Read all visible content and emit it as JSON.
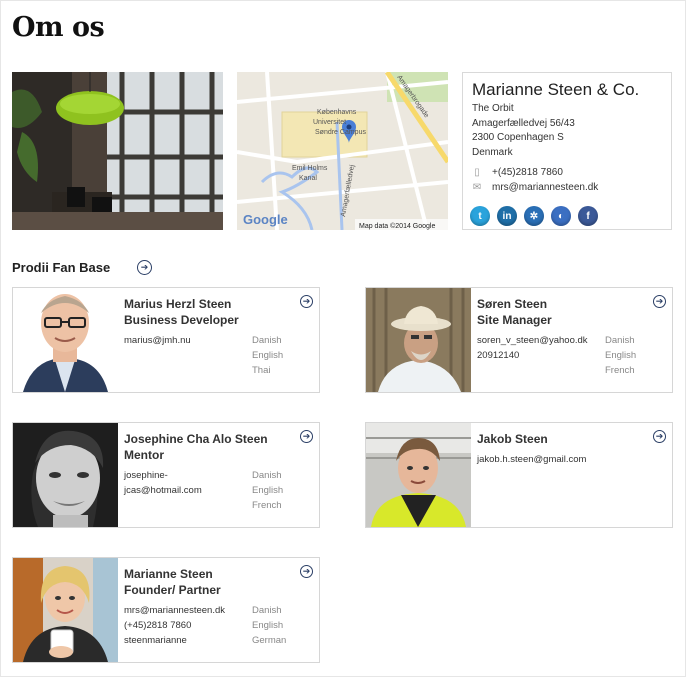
{
  "page": {
    "title": "Om os"
  },
  "company": {
    "name": "Marianne Steen & Co.",
    "address": [
      "The Orbit",
      "Amagerfælledvej 56/43",
      "2300 Copenhagen S",
      "Denmark"
    ],
    "phone": "+(45)2818 7860",
    "email": "mrs@mariannesteen.dk",
    "social": [
      {
        "icon": "twitter-icon",
        "glyph": "t",
        "color": "#2aa3dc"
      },
      {
        "icon": "linkedin-icon",
        "glyph": "in",
        "color": "#1f6fa8"
      },
      {
        "icon": "myspace-icon",
        "glyph": "✲",
        "color": "#2a6fb6"
      },
      {
        "icon": "delicious-icon",
        "glyph": "◐",
        "color": "#3b6fc2"
      },
      {
        "icon": "facebook-icon",
        "glyph": "f",
        "color": "#3b5998"
      }
    ]
  },
  "map": {
    "labels": {
      "university": "Københavns Universitet Søndre Campus",
      "canal": "Emil Holms Kanal",
      "street1": "Amagerfælledvej",
      "street2": "Amagerbrogade",
      "brand": "Google",
      "attribution": "Map data ©2014 Google"
    }
  },
  "fanbase": {
    "title": "Prodii Fan Base",
    "members": [
      {
        "name_lines": [
          "Marius Herzl Steen",
          "Business Developer"
        ],
        "contact": [
          "marius@jmh.nu"
        ],
        "languages": [
          "Danish",
          "English",
          "Thai"
        ]
      },
      {
        "name_lines": [
          "Søren Steen",
          "Site Manager"
        ],
        "contact": [
          "soren_v_steen@yahoo.dk",
          "20912140"
        ],
        "languages": [
          "Danish",
          "English",
          "French"
        ]
      },
      {
        "name_lines": [
          "Josephine Cha Alo Steen",
          "Mentor"
        ],
        "contact": [
          "josephine-",
          "jcas@hotmail.com"
        ],
        "languages": [
          "Danish",
          "English",
          "French"
        ]
      },
      {
        "name_lines": [
          "Jakob Steen"
        ],
        "contact": [
          "jakob.h.steen@gmail.com"
        ],
        "languages": []
      },
      {
        "name_lines": [
          "Marianne Steen",
          "Founder/ Partner"
        ],
        "contact": [
          "mrs@mariannesteen.dk",
          "(+45)2818 7860",
          "steenmarianne"
        ],
        "languages": [
          "Danish",
          "English",
          "German"
        ]
      }
    ]
  }
}
